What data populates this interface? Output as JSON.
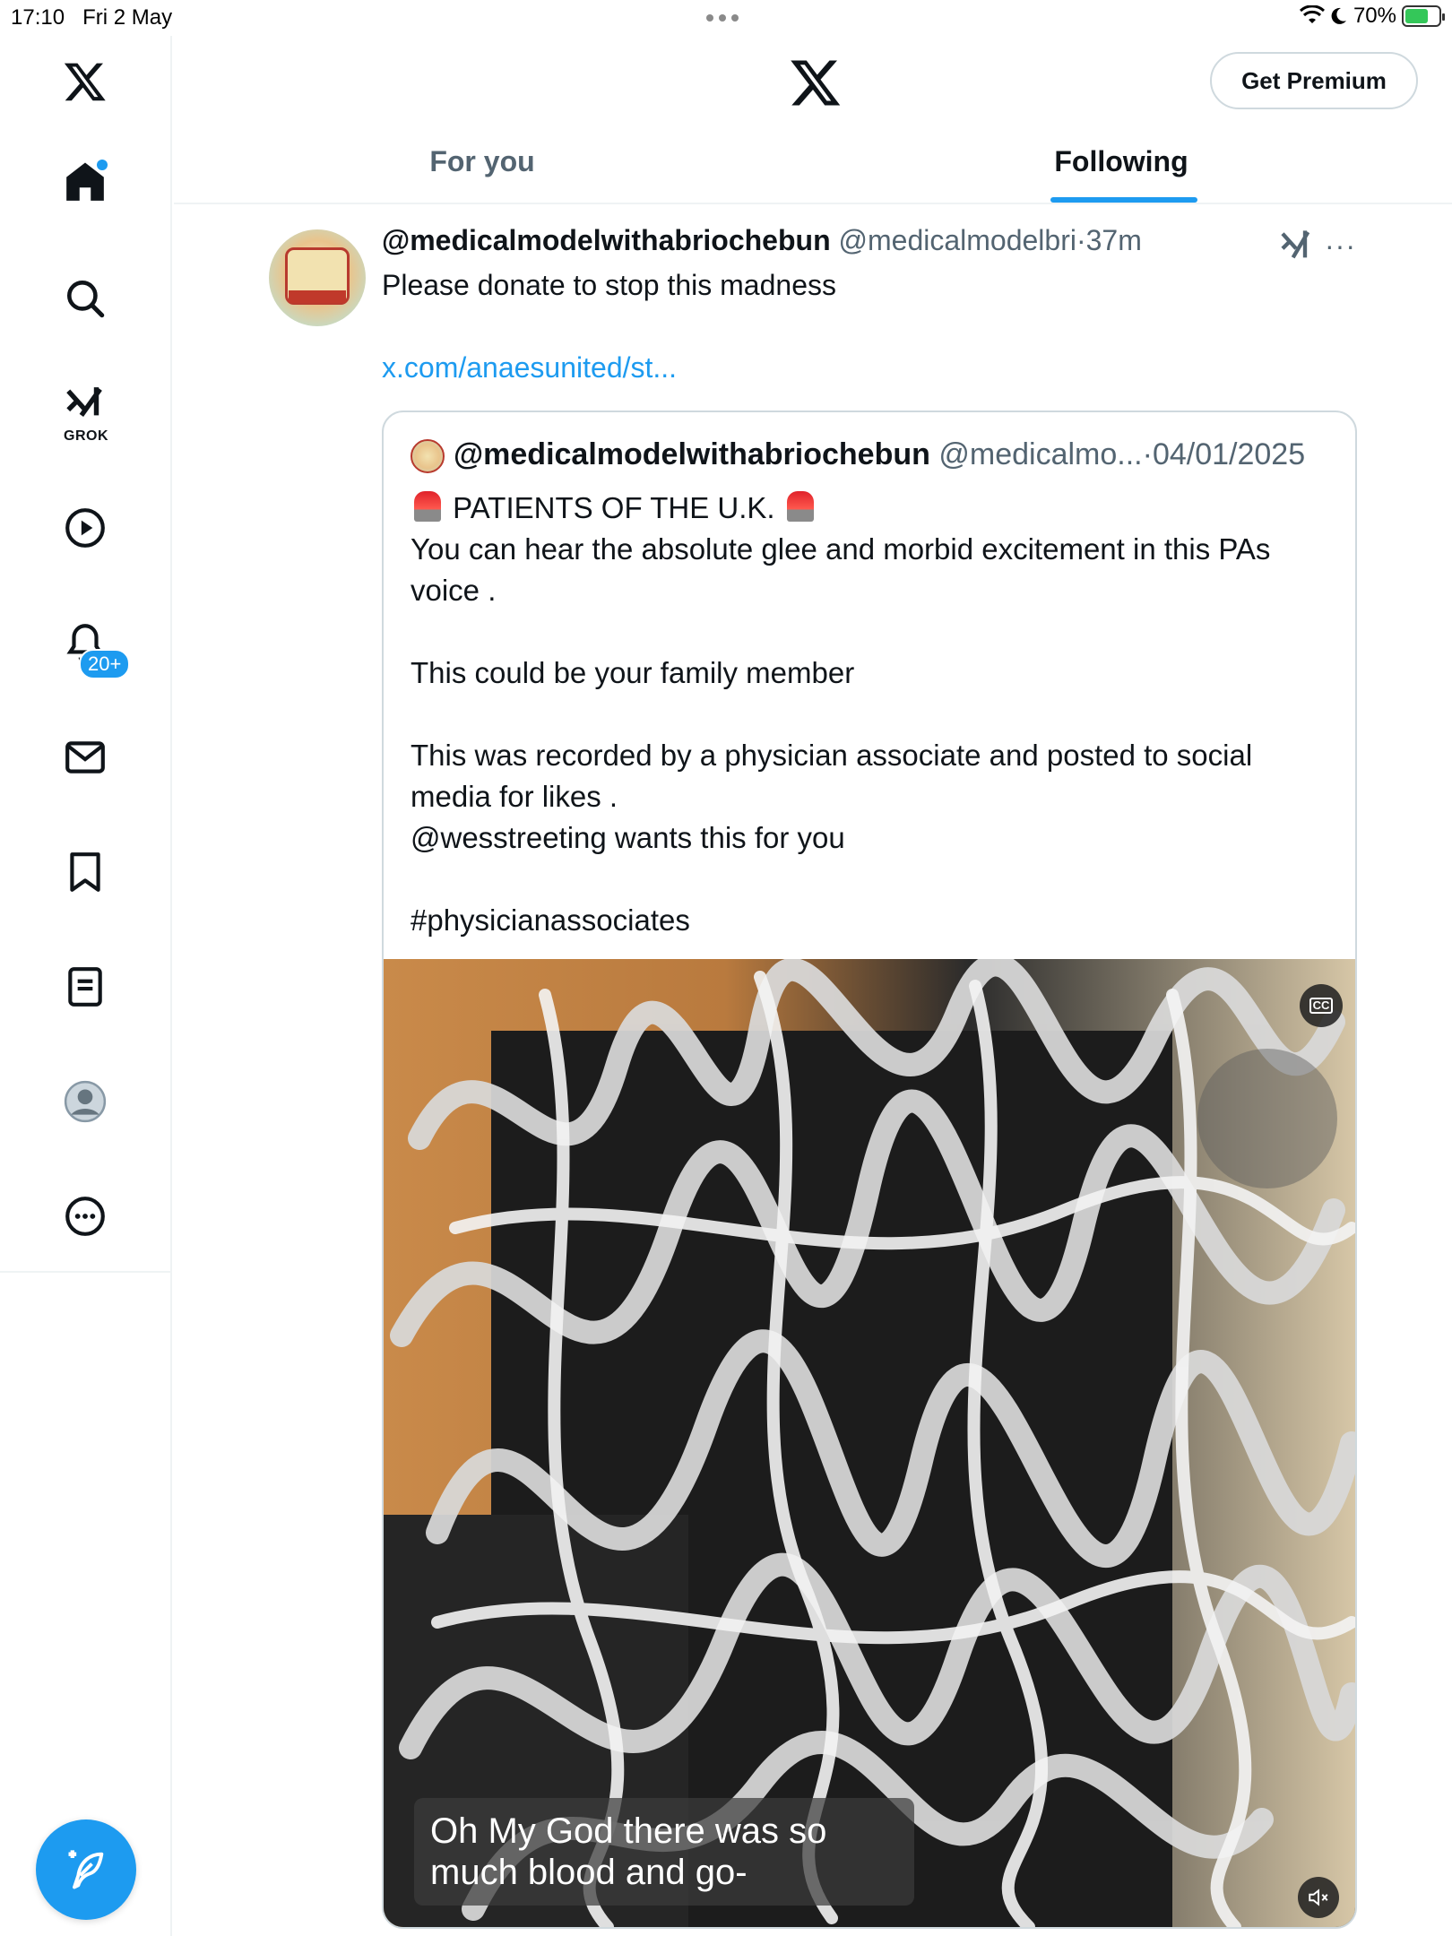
{
  "status_bar": {
    "time": "17:10",
    "date": "Fri 2 May",
    "battery": "70%",
    "battery_level": 0.7,
    "charging": true
  },
  "sidebar": {
    "items": [
      {
        "name": "home",
        "icon": "home-icon"
      },
      {
        "name": "explore",
        "icon": "search-icon"
      },
      {
        "name": "grok",
        "icon": "grok-icon",
        "label": "GROK"
      },
      {
        "name": "video",
        "icon": "play-icon"
      },
      {
        "name": "notifications",
        "icon": "bell-icon",
        "badge": "20+"
      },
      {
        "name": "messages",
        "icon": "mail-icon"
      },
      {
        "name": "bookmarks",
        "icon": "bookmark-icon"
      },
      {
        "name": "lists",
        "icon": "list-icon"
      },
      {
        "name": "profile",
        "icon": "avatar-icon"
      },
      {
        "name": "more",
        "icon": "more-icon"
      }
    ],
    "compose_icon": "feather-icon"
  },
  "header": {
    "premium_label": "Get Premium",
    "tabs": [
      {
        "label": "For you",
        "active": false
      },
      {
        "label": "Following",
        "active": true
      }
    ],
    "accent": "#1d9bf0"
  },
  "post": {
    "display_name": "@medicalmodelwithabriochebun",
    "handle": "@medicalmodelbri",
    "separator": "·",
    "time": "37m",
    "text": "Please donate to stop this madness",
    "link": "x.com/anaesunited/st...",
    "more": "···"
  },
  "quoted": {
    "display_name": "@medicalmodelwithabriochebun",
    "handle": "@medicalmo...",
    "separator": "·",
    "date": "04/01/2025",
    "headline": "PATIENTS OF THE U.K.",
    "body": "You can hear the absolute glee and morbid excitement in this PAs voice .\n\nThis could be your family member\n\nThis was recorded by a physician associate and posted to social media for likes .\n@wesstreeting wants this for you\n\n#physicianassociates",
    "video_caption": "Oh My God there was so much blood and go-",
    "cc_label": "CC"
  }
}
